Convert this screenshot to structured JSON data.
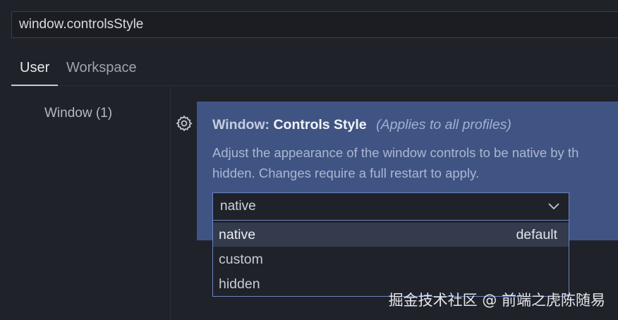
{
  "search": {
    "value": "window.controlsStyle"
  },
  "tabs": [
    {
      "label": "User",
      "active": true
    },
    {
      "label": "Workspace",
      "active": false
    }
  ],
  "toc": {
    "items": [
      {
        "label": "Window (1)"
      }
    ]
  },
  "setting": {
    "category": "Window:",
    "name": "Controls Style",
    "scope_note": "(Applies to all profiles)",
    "description_line1": "Adjust the appearance of the window controls to be native by th",
    "description_line2": "hidden. Changes require a full restart to apply.",
    "icon": "gear-icon"
  },
  "select": {
    "value": "native",
    "options": [
      {
        "label": "native",
        "hint": "default",
        "selected": true
      },
      {
        "label": "custom",
        "hint": "",
        "selected": false
      },
      {
        "label": "hidden",
        "hint": "",
        "selected": false
      }
    ]
  },
  "watermark": {
    "text": "掘金技术社区 @ 前端之虎陈随易"
  },
  "colors": {
    "card_bg": "#405483",
    "page_bg": "#1f2229",
    "focus_border": "#6b85c2"
  }
}
